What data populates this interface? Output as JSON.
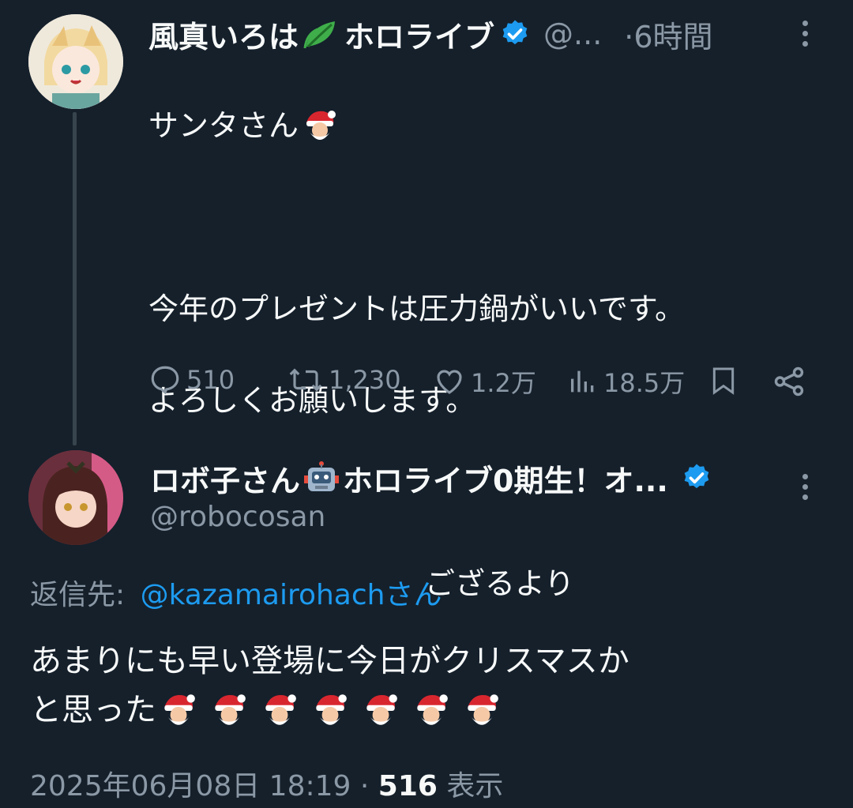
{
  "tweet1": {
    "display_name": "風真いろは",
    "display_name_suffix": "ホロライブ",
    "handle": "@...",
    "time": "·6時間",
    "body_line1": "サンタさん",
    "body_line2": "今年のプレゼントは圧力鍋がいいです。",
    "body_line3": "よろしくお願いします。",
    "signature": "ござるより",
    "actions": {
      "replies": "510",
      "retweets": "1,230",
      "likes": "1.2万",
      "views": "18.5万"
    }
  },
  "tweet2": {
    "display_name": "ロボ子さん",
    "display_name_suffix": "ホロライブ0期生！オ...",
    "handle": "@robocosan",
    "reply_to_label": "返信先:",
    "reply_to_handle": "@kazamairohachさん",
    "body_line1": "あまりにも早い登場に今日がクリスマスか",
    "body_line2": "と思った",
    "santa_count": 7,
    "timestamp": "2025年06月08日 18:19",
    "separator": "·",
    "views_count": "516",
    "views_label": "表示"
  },
  "colors": {
    "background": "#15202b",
    "text": "#f7f9f9",
    "muted": "#8b98a5",
    "accent": "#1d9bf0"
  },
  "icons": [
    "leaf-icon",
    "verified-badge-icon",
    "santa-emoji",
    "robot-emoji",
    "reply-icon",
    "retweet-icon",
    "like-icon",
    "views-icon",
    "bookmark-icon",
    "share-icon",
    "more-icon"
  ]
}
